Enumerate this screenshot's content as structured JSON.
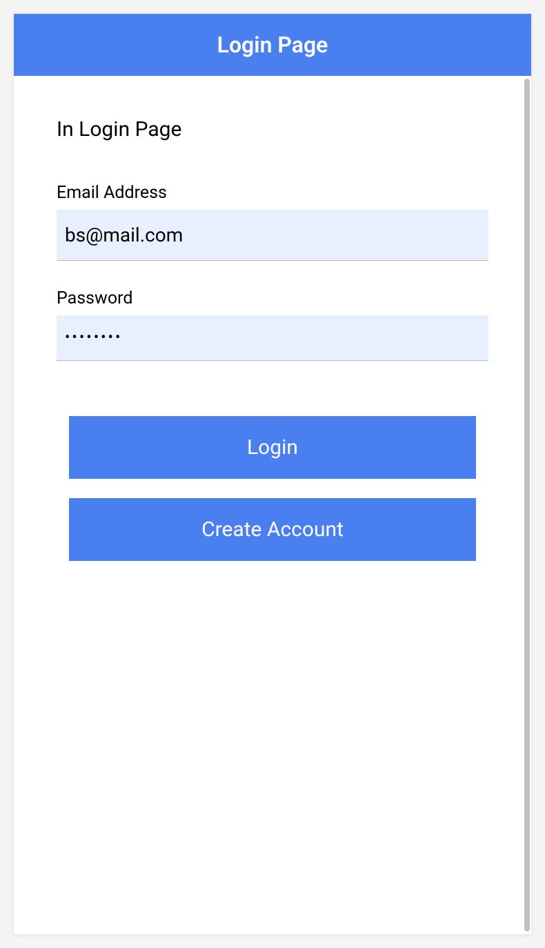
{
  "header": {
    "title": "Login Page"
  },
  "main": {
    "heading": "In Login Page",
    "form": {
      "email_label": "Email Address",
      "email_value": "bs@mail.com",
      "password_label": "Password",
      "password_value": "••••••••"
    },
    "buttons": {
      "login_label": "Login",
      "create_account_label": "Create Account"
    }
  },
  "colors": {
    "primary": "#4a7ff0",
    "input_bg": "#e8efff"
  }
}
